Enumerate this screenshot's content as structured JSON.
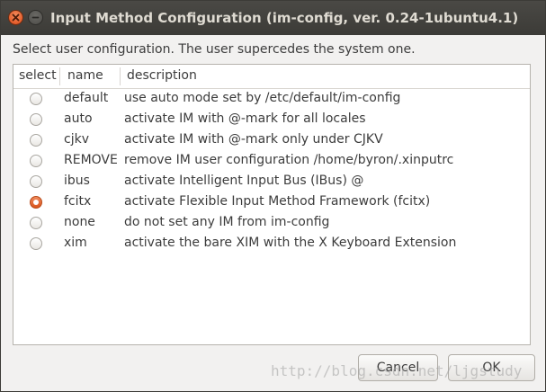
{
  "window": {
    "title": "Input Method Configuration (im-config, ver. 0.24-1ubuntu4.1)"
  },
  "prompt": "Select user configuration. The user supercedes the system one.",
  "table": {
    "columns": [
      "select",
      "name",
      "description"
    ],
    "rows": [
      {
        "name": "default",
        "description": "use auto mode set by /etc/default/im-config",
        "selected": false
      },
      {
        "name": "auto",
        "description": "activate IM with @-mark for all locales",
        "selected": false
      },
      {
        "name": "cjkv",
        "description": "activate IM with @-mark only under CJKV",
        "selected": false
      },
      {
        "name": "REMOVE",
        "description": "remove IM user configuration /home/byron/.xinputrc",
        "selected": false
      },
      {
        "name": "ibus",
        "description": "activate Intelligent Input Bus (IBus) @",
        "selected": false
      },
      {
        "name": "fcitx",
        "description": "activate Flexible Input Method Framework (fcitx)",
        "selected": true
      },
      {
        "name": "none",
        "description": "do not set any IM from im-config",
        "selected": false
      },
      {
        "name": "xim",
        "description": "activate the bare XIM with the X Keyboard Extension",
        "selected": false
      }
    ]
  },
  "buttons": {
    "cancel": "Cancel",
    "ok": "OK"
  },
  "watermark": "http://blog.csdn.net/ljgstudy",
  "colors": {
    "titlebar": "#3c3b37",
    "accent": "#df4a16"
  }
}
